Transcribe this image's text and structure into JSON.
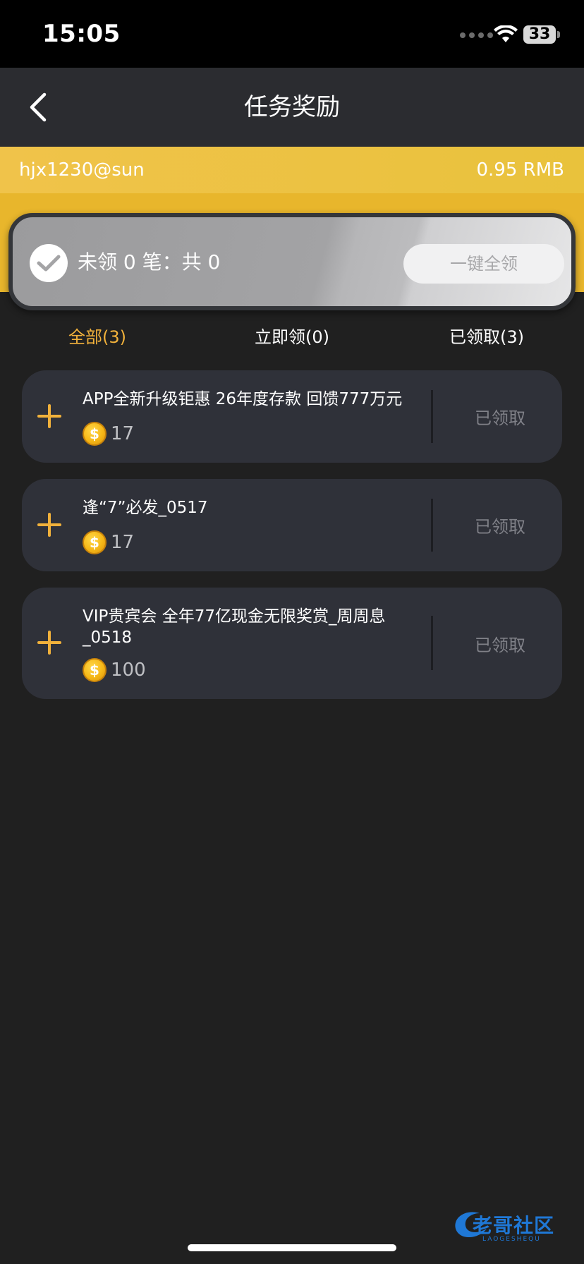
{
  "status_bar": {
    "time": "15:05",
    "battery": "33"
  },
  "nav": {
    "title": "任务奖励"
  },
  "account": {
    "username": "hjx1230@sun",
    "balance": "0.95 RMB"
  },
  "summary": {
    "text": "未领 0 笔：共 0",
    "claim_all_label": "一键全领"
  },
  "tabs": [
    {
      "label": "全部(3)",
      "active": true
    },
    {
      "label": "立即领(0)",
      "active": false
    },
    {
      "label": "已领取(3)",
      "active": false
    }
  ],
  "tasks": [
    {
      "title": "APP全新升级钜惠 26年度存款 回馈777万元",
      "reward": "17",
      "status": "已领取"
    },
    {
      "title": "逢“7”必发_0517",
      "reward": "17",
      "status": "已领取"
    },
    {
      "title": "VIP贵宾会 全年77亿现金无限奖赏_周周息_0518",
      "reward": "100",
      "status": "已领取"
    }
  ],
  "coin_symbol": "$",
  "watermark": {
    "text": "老哥社区",
    "sub": "LAOGESHEQU"
  },
  "colors": {
    "accent": "#f1b13b",
    "gold_band": "#e9c23c",
    "card_bg": "#2f3139",
    "page_bg": "#202020"
  }
}
